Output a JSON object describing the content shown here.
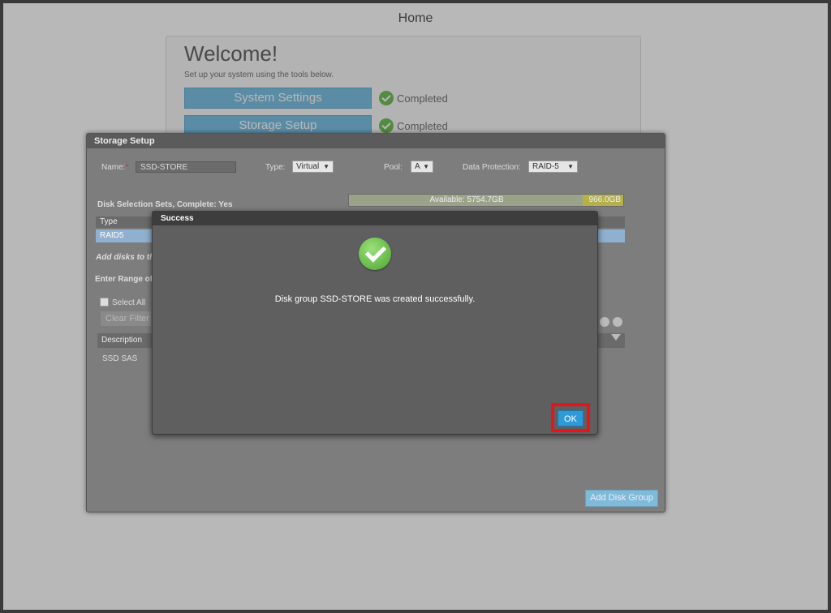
{
  "page": {
    "title": "Home"
  },
  "welcome": {
    "title": "Welcome!",
    "subtitle": "Set up your system using the tools below.",
    "steps": [
      {
        "label": "System Settings",
        "status": "Completed"
      },
      {
        "label": "Storage Setup",
        "status": "Completed"
      }
    ]
  },
  "storage_setup": {
    "title": "Storage Setup",
    "name_label": "Name:",
    "name_value": "SSD-STORE",
    "type_label": "Type:",
    "type_value": "Virtual",
    "pool_label": "Pool:",
    "pool_value": "A",
    "protection_label": "Data Protection:",
    "protection_value": "RAID-5",
    "selection_status": "Disk Selection Sets, Complete: Yes",
    "available_label": "Available: 5754.7GB",
    "used_label": "966.0GB",
    "type_col_header": "Type",
    "type_row_value": "RAID5",
    "add_disks_label": "Add disks to th",
    "enter_range_label": "Enter Range of",
    "select_all_label": "Select All",
    "clear_filter_label": "Clear Filter",
    "description_header": "Description",
    "description_row": "SSD SAS",
    "add_disk_group_label": "Add Disk Group"
  },
  "success_modal": {
    "title": "Success",
    "message": "Disk group SSD-STORE was created successfully.",
    "ok_label": "OK",
    "highlight_color": "#e8141b"
  }
}
